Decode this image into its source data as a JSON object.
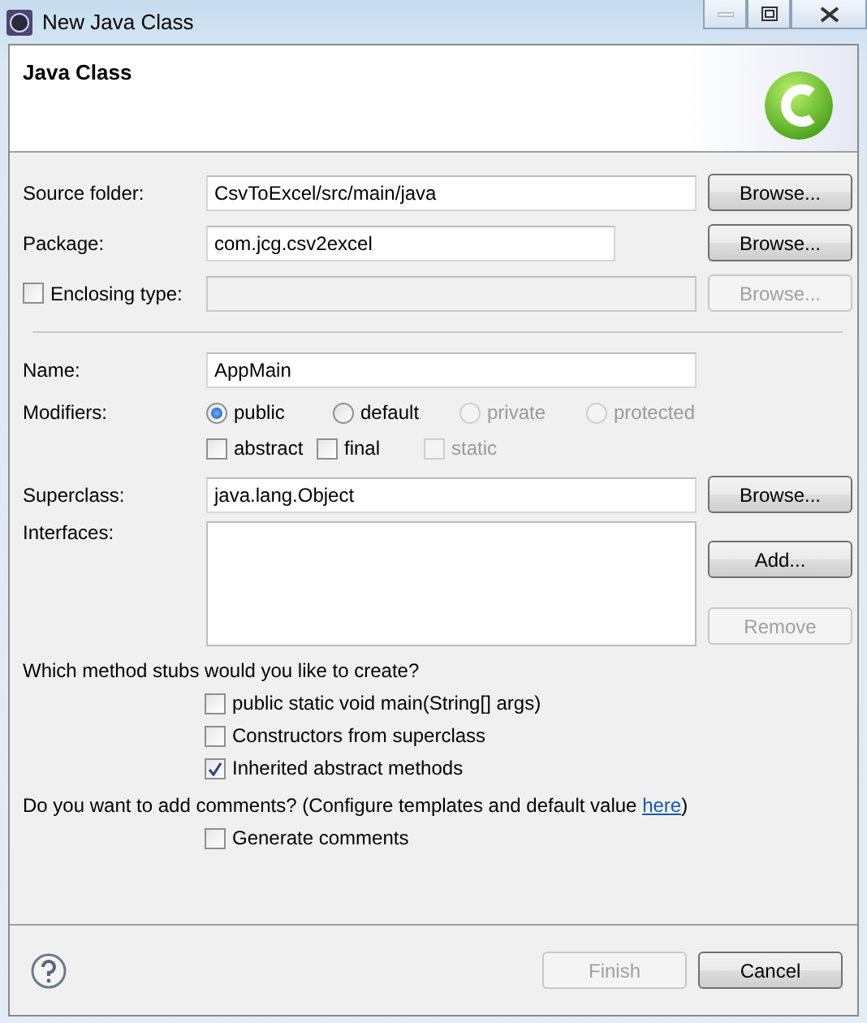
{
  "window": {
    "title": "New Java Class"
  },
  "header": {
    "title": "Java Class"
  },
  "source_folder": {
    "label": "Source folder:",
    "value": "CsvToExcel/src/main/java",
    "button": {
      "label": "Browse...",
      "disabled": false
    }
  },
  "package": {
    "label": "Package:",
    "value": "com.jcg.csv2excel",
    "button": {
      "label": "Browse...",
      "disabled": false
    }
  },
  "enclosing_type": {
    "label": "Enclosing type:",
    "checked": false,
    "button": {
      "label": "Browse...",
      "disabled": true
    }
  },
  "name": {
    "label": "Name:",
    "value": "AppMain"
  },
  "modifiers": {
    "label": "Modifiers:",
    "access": [
      {
        "label": "public",
        "selected": true,
        "disabled": false
      },
      {
        "label": "default",
        "selected": false,
        "disabled": false
      },
      {
        "label": "private",
        "selected": false,
        "disabled": true
      },
      {
        "label": "protected",
        "selected": false,
        "disabled": true
      }
    ],
    "flags": [
      {
        "label": "abstract",
        "checked": false,
        "disabled": false
      },
      {
        "label": "final",
        "checked": false,
        "disabled": false
      },
      {
        "label": "static",
        "checked": false,
        "disabled": true
      }
    ]
  },
  "superclass": {
    "label": "Superclass:",
    "value": "java.lang.Object",
    "button": {
      "label": "Browse...",
      "disabled": false
    }
  },
  "interfaces": {
    "label": "Interfaces:",
    "buttons": [
      {
        "label": "Add...",
        "disabled": false
      },
      {
        "label": "Remove",
        "disabled": true
      }
    ]
  },
  "stubs": {
    "question": "Which method stubs would you like to create?",
    "options": [
      {
        "label": "public static void main(String[] args)",
        "checked": false
      },
      {
        "label": "Constructors from superclass",
        "checked": false
      },
      {
        "label": "Inherited abstract methods",
        "checked": true
      }
    ]
  },
  "comments": {
    "question": "Do you want to add comments? (Configure templates and default value ",
    "link": "here",
    "after": ")",
    "options": [
      {
        "label": "Generate comments",
        "checked": false
      }
    ]
  },
  "footer": {
    "buttons": [
      {
        "label": "Finish",
        "disabled": true
      },
      {
        "label": "Cancel",
        "disabled": false
      }
    ]
  }
}
